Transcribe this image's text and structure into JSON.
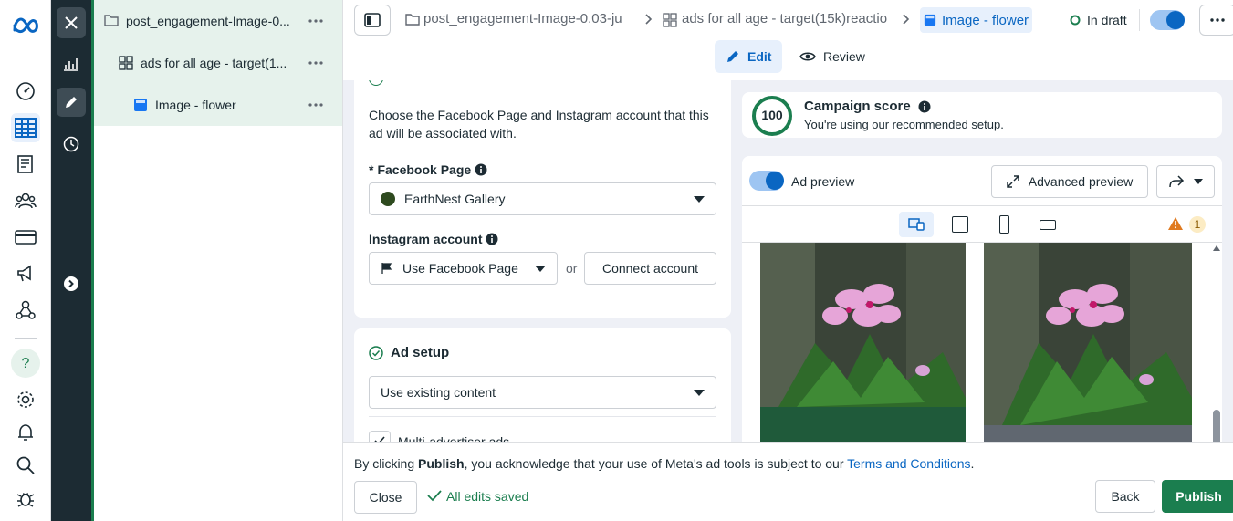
{
  "tree": {
    "campaign": "post_engagement-Image-0...",
    "adset": "ads for all age - target(1...",
    "ad": "Image - flower"
  },
  "breadcrumb": {
    "campaign": "post_engagement-Image-0.03-ju",
    "adset": "ads for all age - target(15k)reactio",
    "ad": "Image - flower",
    "status": "In draft"
  },
  "tabs": {
    "edit": "Edit",
    "review": "Review"
  },
  "identity": {
    "description": "Choose the Facebook Page and Instagram account that this ad will be associated with.",
    "fb_page_label": "Facebook Page",
    "fb_page_required": "*",
    "fb_page_value": "EarthNest Gallery",
    "ig_label": "Instagram account",
    "ig_value": "Use Facebook Page",
    "or": "or",
    "connect": "Connect account"
  },
  "ad_setup": {
    "title": "Ad setup",
    "value": "Use existing content",
    "multi_adv": "Multi-advertiser ads"
  },
  "score": {
    "value": "100",
    "title": "Campaign score",
    "subtitle": "You're using our recommended setup."
  },
  "preview": {
    "toggle_label": "Ad preview",
    "advanced": "Advanced preview",
    "warning_count": "1"
  },
  "footer": {
    "notice_pre": "By clicking ",
    "notice_bold": "Publish",
    "notice_mid": ", you acknowledge that your use of Meta's ad tools is subject to our ",
    "notice_link": "Terms and Conditions",
    "notice_end": ".",
    "close": "Close",
    "saved": "All edits saved",
    "back": "Back",
    "publish": "Publish"
  },
  "colors": {
    "accent": "#0a66c2",
    "publish": "#1b7e4f",
    "dark_strip": "#1c2b33",
    "score_ring": "#1b7e4f"
  }
}
